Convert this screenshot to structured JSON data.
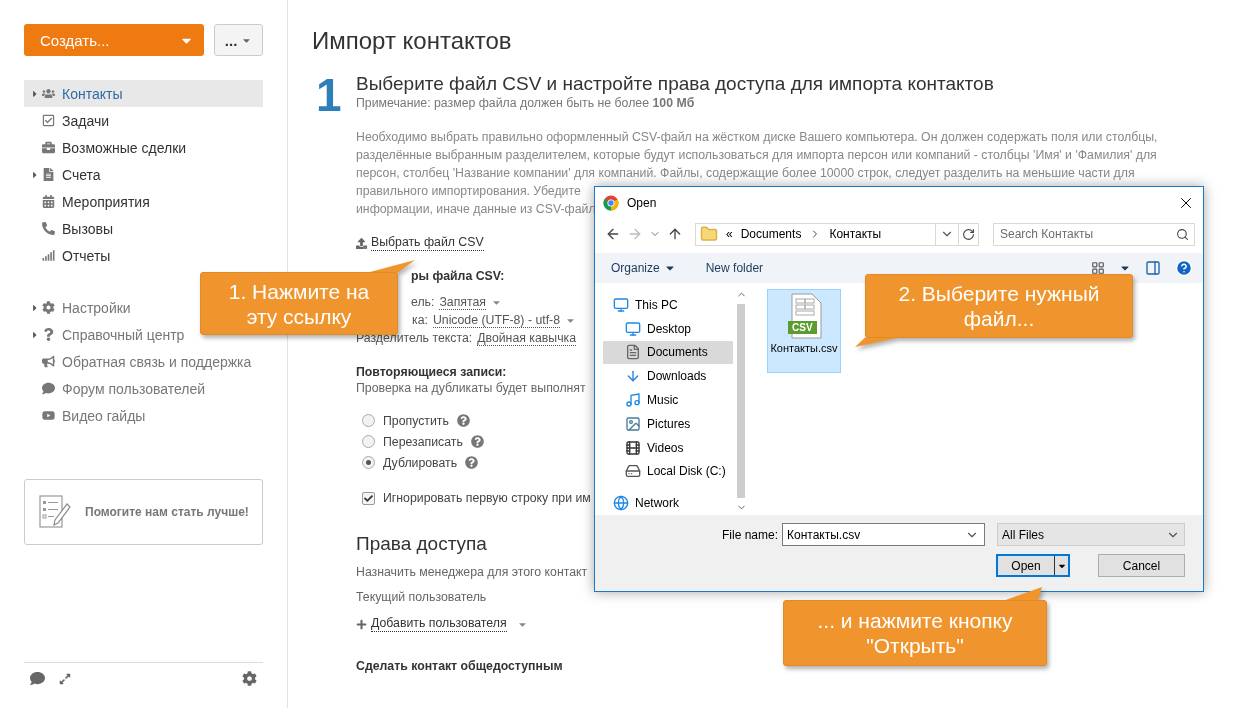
{
  "sidebar": {
    "create_button": {
      "label": "Создать..."
    },
    "more_button": {
      "label": "..."
    },
    "nav": [
      {
        "label": "Контакты",
        "kind": "expandable",
        "selected": true
      },
      {
        "label": "Задачи",
        "kind": "plain",
        "selected": false
      },
      {
        "label": "Возможные сделки",
        "kind": "plain",
        "selected": false
      },
      {
        "label": "Счета",
        "kind": "expandable",
        "selected": false
      },
      {
        "label": "Мероприятия",
        "kind": "plain",
        "selected": false
      },
      {
        "label": "Вызовы",
        "kind": "plain",
        "selected": false
      },
      {
        "label": "Отчеты",
        "kind": "plain",
        "selected": false
      }
    ],
    "help_nav": [
      {
        "label": "Настройки",
        "kind": "expandable"
      },
      {
        "label": "Справочный центр",
        "kind": "expandable"
      },
      {
        "label": "Обратная связь и поддержка",
        "kind": "plain"
      },
      {
        "label": "Форум пользователей",
        "kind": "plain"
      },
      {
        "label": "Видео гайды",
        "kind": "plain"
      }
    ],
    "feedback_card": {
      "label": "Помогите нам стать лучше!"
    }
  },
  "page": {
    "title": "Импорт контактов",
    "step": {
      "number": "1",
      "heading": "Выберите файл CSV и настройте права доступа для импорта контактов",
      "note": "Примечание: размер файла должен быть не более **100 Мб**",
      "description_lines": [
        "Необходимо выбрать правильно оформленный CSV-файл на жёстком диске Вашего компьютера. Он должен содержать поля или столбцы,",
        "разделённые выбранным разделителем, которые будут использоваться для импорта персон или компаний - столбцы 'Имя' и 'Фамилия' для",
        "персон, столбец 'Название компании' для компаний. Файлы, содержащие более 10000 строк, следует разделить на меньшие части для",
        "правильного импортирования. Убедите",
        "информации, иначе данные из CSV-файл"
      ],
      "choose_file_link": "Выбрать файл CSV",
      "params_heading": "ры файла CSV:",
      "params": [
        {
          "label": "ель:",
          "value": "Запятая"
        },
        {
          "label": "ка:",
          "value": "Unicode (UTF-8) - utf-8"
        },
        {
          "label": "Разделитель текста:",
          "value": "Двойная кавычка"
        }
      ],
      "duplicates_heading": "Повторяющиеся записи:",
      "duplicates_note": "Проверка на дубликаты будет выполнят",
      "duplicate_options": [
        {
          "label": "Пропустить",
          "selected": false
        },
        {
          "label": "Перезаписать",
          "selected": false
        },
        {
          "label": "Дублировать",
          "selected": true
        }
      ],
      "ignore_first_row": {
        "label": "Игнорировать первую строку при им",
        "checked": true
      }
    },
    "access": {
      "heading": "Права доступа",
      "manager_note": "Назначить менеджера для этого контакт",
      "current_user": "Текущий пользователь",
      "add_user_link": "Добавить пользователя",
      "public_heading": "Сделать контакт общедоступным"
    }
  },
  "dialog": {
    "title": "Open",
    "path_overflow": "«",
    "path": [
      "Documents",
      "Контакты"
    ],
    "search": {
      "placeholder": "Search Контакты"
    },
    "organize": "Organize",
    "new_folder": "New folder",
    "nav_tree": [
      {
        "label": "This PC",
        "selected": false,
        "children": [
          {
            "label": "Desktop",
            "selected": false
          },
          {
            "label": "Documents",
            "selected": true
          },
          {
            "label": "Downloads",
            "selected": false
          },
          {
            "label": "Music",
            "selected": false
          },
          {
            "label": "Pictures",
            "selected": false
          },
          {
            "label": "Videos",
            "selected": false
          },
          {
            "label": "Local Disk (C:)",
            "selected": false
          }
        ]
      },
      {
        "label": "Network",
        "selected": false
      }
    ],
    "files": [
      {
        "name": "Контакты.csv",
        "badge": "CSV",
        "selected": true
      }
    ],
    "file_name": {
      "label": "File name:",
      "value": "Контакты.csv"
    },
    "file_type": "All Files",
    "open_button": "Open",
    "cancel_button": "Cancel"
  },
  "callouts": [
    {
      "text": "1. Нажмите на эту ссылку"
    },
    {
      "text": "2. Выберите нужный файл..."
    },
    {
      "text": "... и нажмите кнопку \"Открыть\""
    }
  ]
}
